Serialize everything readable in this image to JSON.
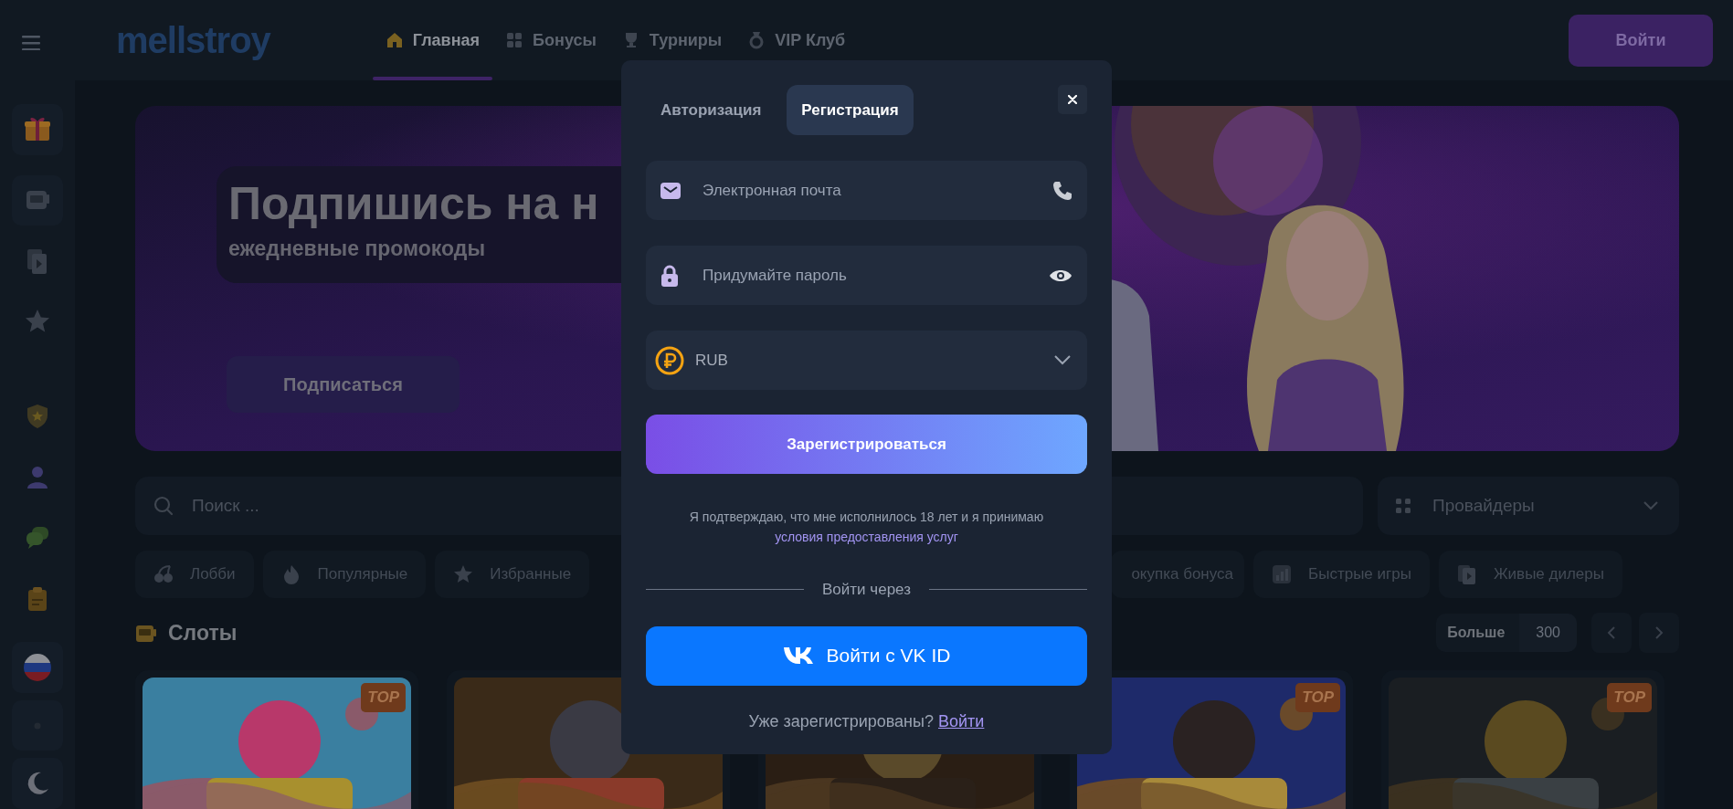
{
  "header": {
    "logo": "mellstroy",
    "nav": [
      {
        "label": "Главная",
        "selected": true
      },
      {
        "label": "Бонусы",
        "selected": false
      },
      {
        "label": "Турниры",
        "selected": false
      },
      {
        "label": "VIP Клуб",
        "selected": false
      }
    ],
    "login_button": "Войти"
  },
  "banner": {
    "title": "Подпишись на н",
    "subtitle": "ежедневные промокоды",
    "button": "Подписаться"
  },
  "search": {
    "placeholder": "Поиск ..."
  },
  "providers": {
    "label": "Провайдеры"
  },
  "categories": [
    {
      "label": "Лобби"
    },
    {
      "label": "Популярные"
    },
    {
      "label": "Избранные"
    },
    {
      "label": "окупка бонуса"
    },
    {
      "label": "Быстрые игры"
    },
    {
      "label": "Живые дилеры"
    }
  ],
  "section": {
    "title": "Слоты",
    "more": "Больше",
    "count": "300"
  },
  "games": [
    {
      "kind": "picture",
      "badge": "TOP"
    },
    {
      "kind": "picture"
    },
    {
      "kind": "picture"
    },
    {
      "kind": "picture",
      "badge": "TOP"
    },
    {
      "kind": "picture",
      "badge": "TOP"
    }
  ],
  "modal": {
    "tabs": [
      {
        "label": "Авторизация",
        "selected": false
      },
      {
        "label": "Регистрация",
        "selected": true
      }
    ],
    "fields": [
      {
        "kind": "email",
        "placeholder": "Электронная почта"
      },
      {
        "kind": "password",
        "placeholder": "Придумайте пароль"
      },
      {
        "kind": "select",
        "value": "RUB"
      }
    ],
    "submit": "Зарегистрироваться",
    "terms": "Я подтверждаю, что мне исполнилось 18 лет и я принимаю",
    "terms_link": "условия предоставления услуг",
    "divider": "Войти через",
    "vk_button": "Войти с VK ID",
    "footer": "Уже зарегистрированы?",
    "footer_link": "Войти"
  }
}
